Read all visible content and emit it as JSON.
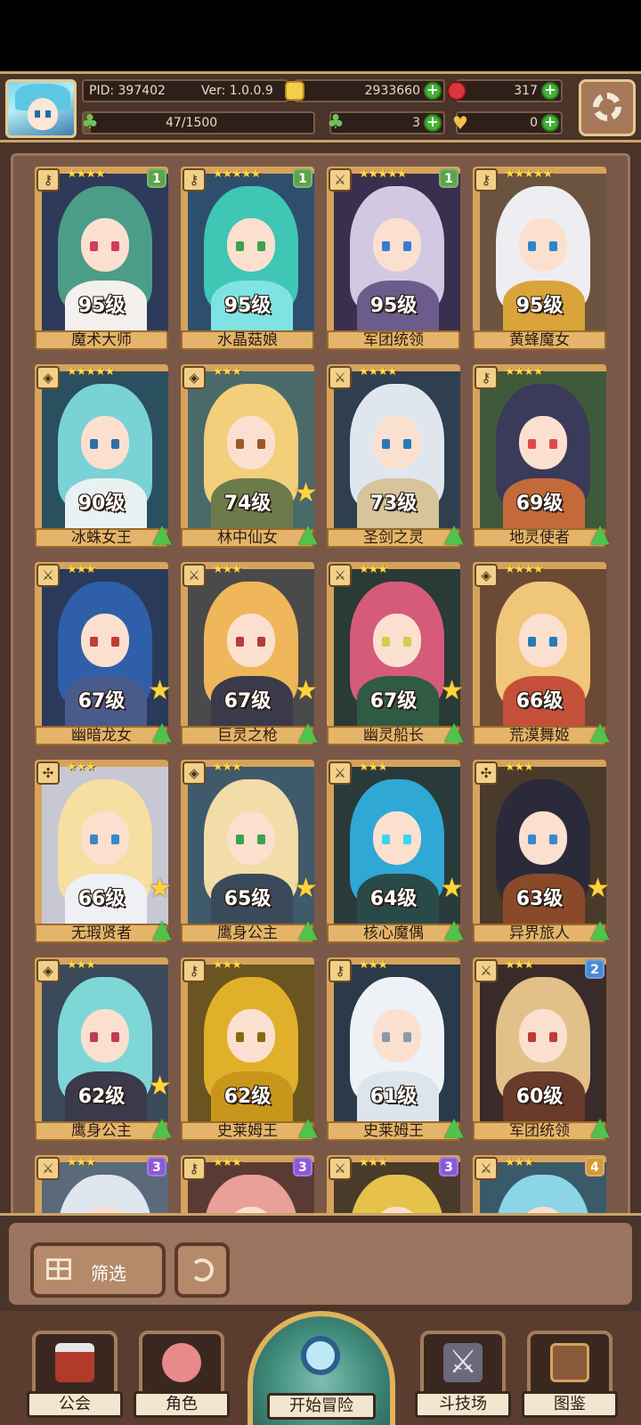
{
  "player": {
    "pid": "PID: 397402",
    "version": "Ver: 1.0.0.9",
    "stamina": "47/1500",
    "stamina_fraction": 0.031,
    "currencies": [
      {
        "name": "coin",
        "value": "2933660",
        "icon": "coin-icon"
      },
      {
        "name": "gem",
        "value": "317",
        "icon": "ruby-icon"
      },
      {
        "name": "clover",
        "value": "3",
        "icon": "clover-icon"
      },
      {
        "name": "bag",
        "value": "0",
        "icon": "bag-icon"
      }
    ]
  },
  "heroes": [
    {
      "level": "95级",
      "name": "魔术大师",
      "stars": "★★★★",
      "badge": "1",
      "badge_color": "#5da44a",
      "class": "key",
      "hair": "#4c9d87",
      "body": "#f3f0ee",
      "eye": "#d03c5c",
      "bg": "#2d3a5a",
      "star_badge": false,
      "up": false
    },
    {
      "level": "95级",
      "name": "水晶菇娘",
      "stars": "★★★★★",
      "badge": "1",
      "badge_color": "#5da44a",
      "class": "key",
      "hair": "#3fc6b4",
      "body": "#7fe3e3",
      "eye": "#3aa34b",
      "bg": "#2e4e6e",
      "star_badge": false,
      "up": false
    },
    {
      "level": "95级",
      "name": "军团统领",
      "stars": "★★★★★",
      "badge": "1",
      "badge_color": "#5da44a",
      "class": "sword",
      "hair": "#d2c8e2",
      "body": "#6c5c8c",
      "eye": "#3a7ad3",
      "bg": "#3a2f4f",
      "star_badge": false,
      "up": false
    },
    {
      "level": "95级",
      "name": "黄蜂魔女",
      "stars": "★★★★★",
      "badge": "",
      "badge_color": "",
      "class": "key",
      "hair": "#eeeef2",
      "body": "#d9a53a",
      "eye": "#2a88c8",
      "bg": "#6a5440",
      "star_badge": false,
      "up": false
    },
    {
      "level": "90级",
      "name": "冰蛛女王",
      "stars": "★★★★★",
      "badge": "",
      "badge_color": "",
      "class": "shield",
      "hair": "#79d2d6",
      "body": "#e9f2f2",
      "eye": "#2e6fa8",
      "bg": "#2a4f5f",
      "star_badge": false,
      "up": true
    },
    {
      "level": "74级",
      "name": "林中仙女",
      "stars": "★★★",
      "badge": "",
      "badge_color": "",
      "class": "shield",
      "hair": "#f2cf7a",
      "body": "#6d7b4a",
      "eye": "#9a5a2a",
      "bg": "#4a6a6a",
      "star_badge": true,
      "up": true
    },
    {
      "level": "73级",
      "name": "圣剑之灵",
      "stars": "★★★★",
      "badge": "",
      "badge_color": "",
      "class": "sword",
      "hair": "#e0e6ee",
      "body": "#d8c49a",
      "eye": "#2a78b8",
      "bg": "#2f3f4f",
      "star_badge": false,
      "up": true
    },
    {
      "level": "69级",
      "name": "地灵使者",
      "stars": "★★★★",
      "badge": "",
      "badge_color": "",
      "class": "key",
      "hair": "#3a3a5a",
      "body": "#c46a3a",
      "eye": "#e04a4a",
      "bg": "#3f5a3a",
      "star_badge": false,
      "up": true
    },
    {
      "level": "67级",
      "name": "幽暗龙女",
      "stars": "★★★",
      "badge": "",
      "badge_color": "",
      "class": "sword",
      "hair": "#2f5fa8",
      "body": "#4a5a8a",
      "eye": "#c23a3a",
      "bg": "#2a3a5a",
      "star_badge": true,
      "up": true
    },
    {
      "level": "67级",
      "name": "巨灵之枪",
      "stars": "★★★",
      "badge": "",
      "badge_color": "",
      "class": "sword",
      "hair": "#efb75a",
      "body": "#3a3a4a",
      "eye": "#b83a3a",
      "bg": "#4a4a4a",
      "star_badge": true,
      "up": true
    },
    {
      "level": "67级",
      "name": "幽灵船长",
      "stars": "★★★",
      "badge": "",
      "badge_color": "",
      "class": "sword",
      "hair": "#d65a7a",
      "body": "#2f5a44",
      "eye": "#d0d04a",
      "bg": "#2a3a34",
      "star_badge": true,
      "up": true
    },
    {
      "level": "66级",
      "name": "荒漠舞姬",
      "stars": "★★★★",
      "badge": "",
      "badge_color": "",
      "class": "shield",
      "hair": "#f0c67a",
      "body": "#c4503a",
      "eye": "#2a7ab8",
      "bg": "#6a4a34",
      "star_badge": false,
      "up": true
    },
    {
      "level": "66级",
      "name": "无瑕贤者",
      "stars": "★★★",
      "badge": "",
      "badge_color": "",
      "class": "cross",
      "hair": "#f6dfa0",
      "body": "#eef0f6",
      "eye": "#3a88c8",
      "bg": "#c8c8d4",
      "star_badge": true,
      "up": true
    },
    {
      "level": "65级",
      "name": "鹰身公主",
      "stars": "★★★",
      "badge": "",
      "badge_color": "",
      "class": "shield",
      "hair": "#f2dca8",
      "body": "#3a4a5a",
      "eye": "#3aa34b",
      "bg": "#3f5a6a",
      "star_badge": true,
      "up": true
    },
    {
      "level": "64级",
      "name": "核心魔偶",
      "stars": "★★★",
      "badge": "",
      "badge_color": "",
      "class": "sword",
      "hair": "#2fa8d6",
      "body": "#2a4a4a",
      "eye": "#3ad6f0",
      "bg": "#2a3a3a",
      "star_badge": true,
      "up": true
    },
    {
      "level": "63级",
      "name": "异界旅人",
      "stars": "★★★",
      "badge": "",
      "badge_color": "",
      "class": "cross",
      "hair": "#2a2a3a",
      "body": "#8a4a2a",
      "eye": "#3a88c8",
      "bg": "#4a3a2a",
      "star_badge": true,
      "up": true
    },
    {
      "level": "62级",
      "name": "鹰身公主",
      "stars": "★★★",
      "badge": "",
      "badge_color": "",
      "class": "shield",
      "hair": "#7fd6d6",
      "body": "#3a3a4a",
      "eye": "#c23a5a",
      "bg": "#3a4a5a",
      "star_badge": true,
      "up": true
    },
    {
      "level": "62级",
      "name": "史莱姆王",
      "stars": "★★★",
      "badge": "",
      "badge_color": "",
      "class": "key",
      "hair": "#e0b02a",
      "body": "#c8961a",
      "eye": "#8a6a10",
      "bg": "#6a5420",
      "star_badge": false,
      "up": true
    },
    {
      "level": "61级",
      "name": "史莱姆王",
      "stars": "★★★",
      "badge": "",
      "badge_color": "",
      "class": "key",
      "hair": "#eef2f6",
      "body": "#dce4ec",
      "eye": "#8a9aaa",
      "bg": "#2a3a4a",
      "star_badge": false,
      "up": true
    },
    {
      "level": "60级",
      "name": "军团统领",
      "stars": "★★★",
      "badge": "2",
      "badge_color": "#4a8ad6",
      "class": "sword",
      "hair": "#e2c08a",
      "body": "#6a3a2a",
      "eye": "#c23a3a",
      "bg": "#3a2a2a",
      "star_badge": false,
      "up": true
    },
    {
      "level": "",
      "name": "",
      "stars": "★★★",
      "badge": "3",
      "badge_color": "#8a5ad6",
      "class": "sword",
      "hair": "#dfe6ee",
      "body": "#a0b8cc",
      "eye": "#2a78b8",
      "bg": "#5a6a7a",
      "star_badge": false,
      "up": false
    },
    {
      "level": "",
      "name": "",
      "stars": "★★★",
      "badge": "3",
      "badge_color": "#8a5ad6",
      "class": "key",
      "hair": "#e8a098",
      "body": "#c47a6a",
      "eye": "#6a3a2a",
      "bg": "#5a3a34",
      "star_badge": false,
      "up": false
    },
    {
      "level": "",
      "name": "",
      "stars": "★★★",
      "badge": "3",
      "badge_color": "#8a5ad6",
      "class": "sword",
      "hair": "#e6c24a",
      "body": "#c8a02a",
      "eye": "#6a4a10",
      "bg": "#4a3a2a",
      "star_badge": false,
      "up": false
    },
    {
      "level": "",
      "name": "",
      "stars": "★★★",
      "badge": "4",
      "badge_color": "#d69a3a",
      "class": "sword",
      "hair": "#8ad6e6",
      "body": "#f2e4b0",
      "eye": "#2a78b8",
      "bg": "#3a5a6a",
      "star_badge": false,
      "up": false
    }
  ],
  "filter": {
    "label": "筛选"
  },
  "nav": {
    "guild": "公会",
    "roles": "角色",
    "adventure": "开始冒险",
    "arena": "斗技场",
    "codex": "图鉴"
  },
  "class_glyphs": {
    "key": "⚷",
    "sword": "⚔",
    "shield": "◈",
    "cross": "✣"
  }
}
